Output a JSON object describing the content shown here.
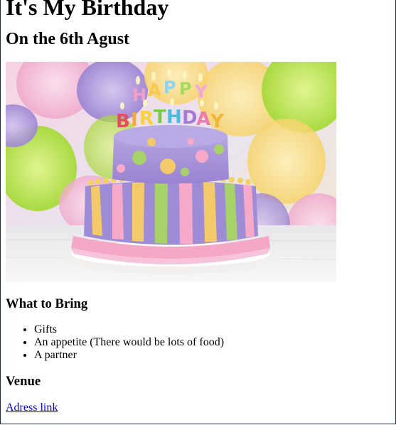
{
  "page": {
    "title": "It's My Birthday",
    "subtitle": "On the 6th Agust"
  },
  "image": {
    "description_icon": "birthday-cake-image",
    "colors": {
      "bg_balloon_pink": "#f3b7d4",
      "bg_balloon_green": "#b7e04a",
      "bg_balloon_purple": "#a98ad6",
      "cake_purple": "#a792d6",
      "cake_pink": "#f4a7c7",
      "table": "#f1f1f1"
    }
  },
  "bring": {
    "heading": "What to Bring",
    "items": [
      {
        "label": "Gifts"
      },
      {
        "label": "An appetite (There would be lots of food)"
      },
      {
        "label": "A partner"
      }
    ]
  },
  "venue": {
    "heading": "Venue",
    "link_label": "Adress link"
  }
}
